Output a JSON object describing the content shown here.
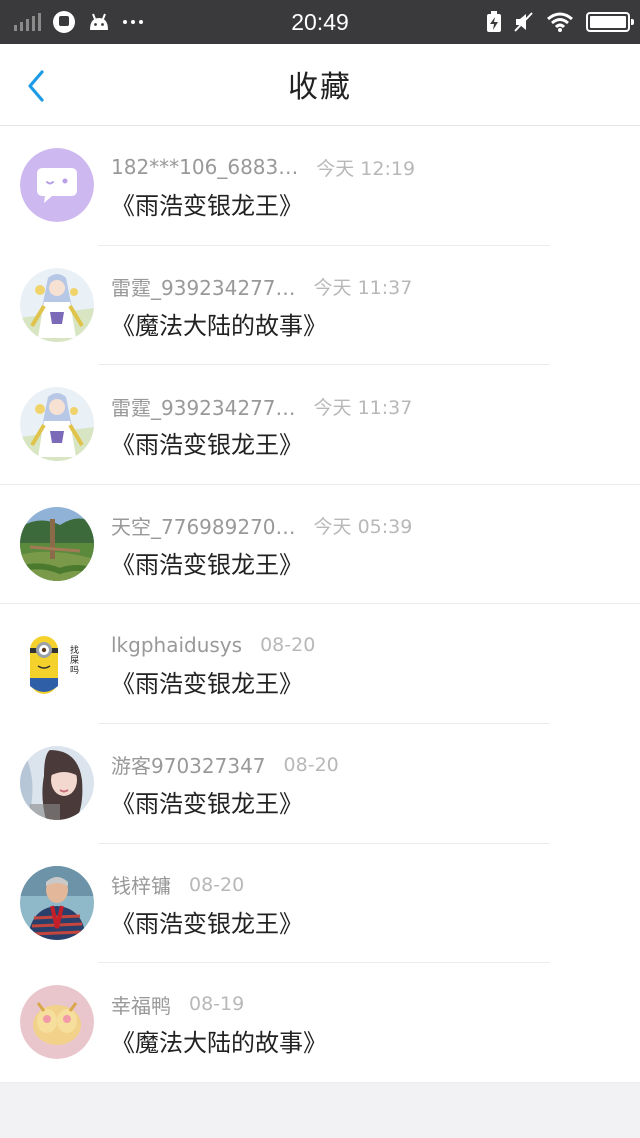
{
  "status_bar": {
    "time": "20:49",
    "signal_strength": 0,
    "battery_level": 1.0,
    "icons": [
      "signal-icon",
      "gallery-icon",
      "android-icon",
      "more-dots-icon",
      "charging-icon",
      "mute-icon",
      "wifi-icon",
      "battery-icon"
    ]
  },
  "header": {
    "title": "收藏",
    "back_icon": "chevron-left-icon",
    "accent_color": "#1e9be6"
  },
  "favorites": [
    {
      "user": "182***106_6883…",
      "time": "今天 12:19",
      "book": "《雨浩变银龙王》",
      "avatar": "chat-bubble-avatar"
    },
    {
      "user": "雷霆_939234277…",
      "time": "今天 11:37",
      "book": "《魔法大陆的故事》",
      "avatar": "anime-character-avatar"
    },
    {
      "user": "雷霆_939234277…",
      "time": "今天 11:37",
      "book": "《雨浩变银龙王》",
      "avatar": "anime-character-avatar"
    },
    {
      "user": "天空_776989270…",
      "time": "今天 05:39",
      "book": "《雨浩变银龙王》",
      "avatar": "garden-photo-avatar"
    },
    {
      "user": "lkgphaidusys",
      "time": "08-20",
      "book": "《雨浩变银龙王》",
      "avatar": "minion-avatar",
      "avatar_text": "找屎吗"
    },
    {
      "user": "游客970327347",
      "time": "08-20",
      "book": "《雨浩变银龙王》",
      "avatar": "girl-photo-avatar"
    },
    {
      "user": "钱梓镛",
      "time": "08-20",
      "book": "《雨浩变银龙王》",
      "avatar": "man-photo-avatar"
    },
    {
      "user": "幸福鸭",
      "time": "08-19",
      "book": "《魔法大陆的故事》",
      "avatar": "cake-photo-avatar"
    }
  ]
}
